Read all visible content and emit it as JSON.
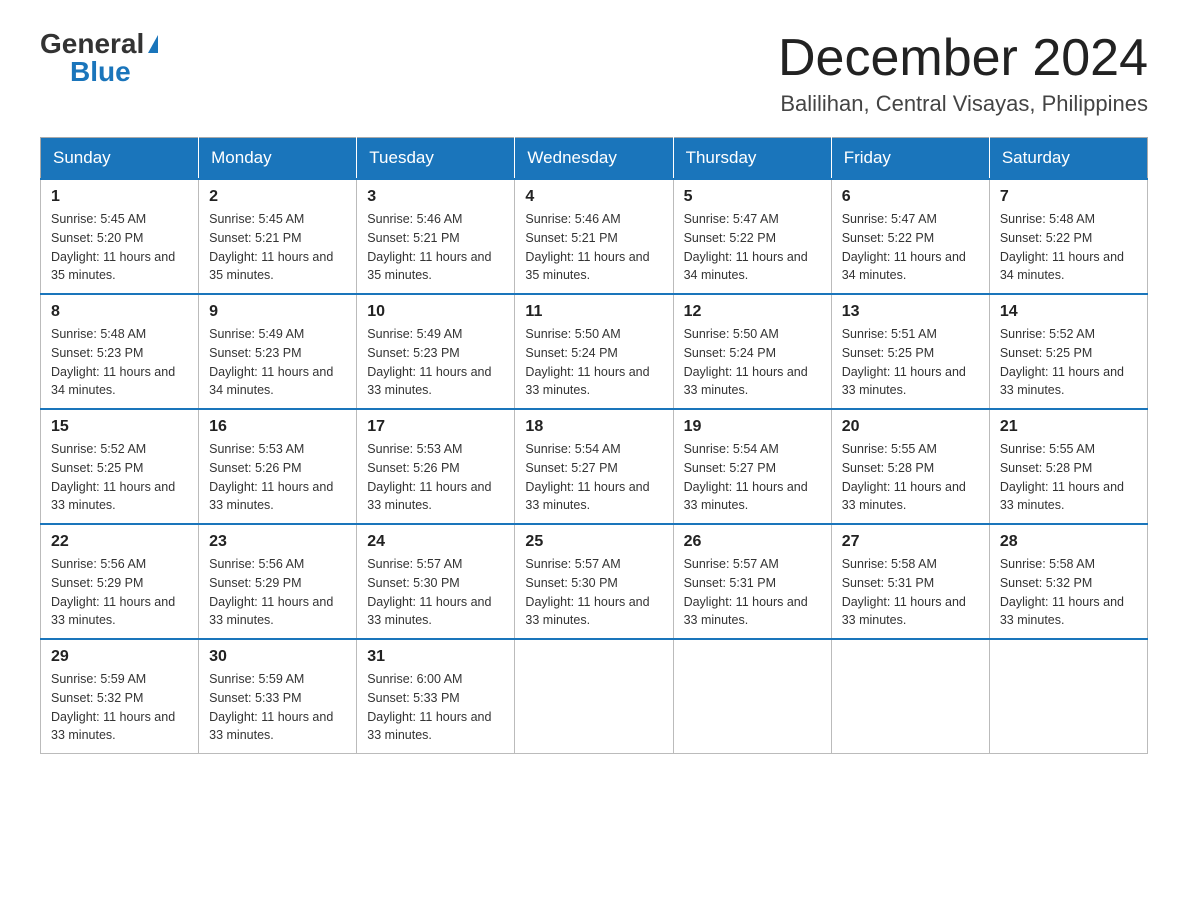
{
  "header": {
    "logo_general": "General",
    "logo_blue": "Blue",
    "month_title": "December 2024",
    "location": "Balilihan, Central Visayas, Philippines"
  },
  "days_of_week": [
    "Sunday",
    "Monday",
    "Tuesday",
    "Wednesday",
    "Thursday",
    "Friday",
    "Saturday"
  ],
  "weeks": [
    [
      {
        "day": "1",
        "sunrise": "5:45 AM",
        "sunset": "5:20 PM",
        "daylight": "11 hours and 35 minutes."
      },
      {
        "day": "2",
        "sunrise": "5:45 AM",
        "sunset": "5:21 PM",
        "daylight": "11 hours and 35 minutes."
      },
      {
        "day": "3",
        "sunrise": "5:46 AM",
        "sunset": "5:21 PM",
        "daylight": "11 hours and 35 minutes."
      },
      {
        "day": "4",
        "sunrise": "5:46 AM",
        "sunset": "5:21 PM",
        "daylight": "11 hours and 35 minutes."
      },
      {
        "day": "5",
        "sunrise": "5:47 AM",
        "sunset": "5:22 PM",
        "daylight": "11 hours and 34 minutes."
      },
      {
        "day": "6",
        "sunrise": "5:47 AM",
        "sunset": "5:22 PM",
        "daylight": "11 hours and 34 minutes."
      },
      {
        "day": "7",
        "sunrise": "5:48 AM",
        "sunset": "5:22 PM",
        "daylight": "11 hours and 34 minutes."
      }
    ],
    [
      {
        "day": "8",
        "sunrise": "5:48 AM",
        "sunset": "5:23 PM",
        "daylight": "11 hours and 34 minutes."
      },
      {
        "day": "9",
        "sunrise": "5:49 AM",
        "sunset": "5:23 PM",
        "daylight": "11 hours and 34 minutes."
      },
      {
        "day": "10",
        "sunrise": "5:49 AM",
        "sunset": "5:23 PM",
        "daylight": "11 hours and 33 minutes."
      },
      {
        "day": "11",
        "sunrise": "5:50 AM",
        "sunset": "5:24 PM",
        "daylight": "11 hours and 33 minutes."
      },
      {
        "day": "12",
        "sunrise": "5:50 AM",
        "sunset": "5:24 PM",
        "daylight": "11 hours and 33 minutes."
      },
      {
        "day": "13",
        "sunrise": "5:51 AM",
        "sunset": "5:25 PM",
        "daylight": "11 hours and 33 minutes."
      },
      {
        "day": "14",
        "sunrise": "5:52 AM",
        "sunset": "5:25 PM",
        "daylight": "11 hours and 33 minutes."
      }
    ],
    [
      {
        "day": "15",
        "sunrise": "5:52 AM",
        "sunset": "5:25 PM",
        "daylight": "11 hours and 33 minutes."
      },
      {
        "day": "16",
        "sunrise": "5:53 AM",
        "sunset": "5:26 PM",
        "daylight": "11 hours and 33 minutes."
      },
      {
        "day": "17",
        "sunrise": "5:53 AM",
        "sunset": "5:26 PM",
        "daylight": "11 hours and 33 minutes."
      },
      {
        "day": "18",
        "sunrise": "5:54 AM",
        "sunset": "5:27 PM",
        "daylight": "11 hours and 33 minutes."
      },
      {
        "day": "19",
        "sunrise": "5:54 AM",
        "sunset": "5:27 PM",
        "daylight": "11 hours and 33 minutes."
      },
      {
        "day": "20",
        "sunrise": "5:55 AM",
        "sunset": "5:28 PM",
        "daylight": "11 hours and 33 minutes."
      },
      {
        "day": "21",
        "sunrise": "5:55 AM",
        "sunset": "5:28 PM",
        "daylight": "11 hours and 33 minutes."
      }
    ],
    [
      {
        "day": "22",
        "sunrise": "5:56 AM",
        "sunset": "5:29 PM",
        "daylight": "11 hours and 33 minutes."
      },
      {
        "day": "23",
        "sunrise": "5:56 AM",
        "sunset": "5:29 PM",
        "daylight": "11 hours and 33 minutes."
      },
      {
        "day": "24",
        "sunrise": "5:57 AM",
        "sunset": "5:30 PM",
        "daylight": "11 hours and 33 minutes."
      },
      {
        "day": "25",
        "sunrise": "5:57 AM",
        "sunset": "5:30 PM",
        "daylight": "11 hours and 33 minutes."
      },
      {
        "day": "26",
        "sunrise": "5:57 AM",
        "sunset": "5:31 PM",
        "daylight": "11 hours and 33 minutes."
      },
      {
        "day": "27",
        "sunrise": "5:58 AM",
        "sunset": "5:31 PM",
        "daylight": "11 hours and 33 minutes."
      },
      {
        "day": "28",
        "sunrise": "5:58 AM",
        "sunset": "5:32 PM",
        "daylight": "11 hours and 33 minutes."
      }
    ],
    [
      {
        "day": "29",
        "sunrise": "5:59 AM",
        "sunset": "5:32 PM",
        "daylight": "11 hours and 33 minutes."
      },
      {
        "day": "30",
        "sunrise": "5:59 AM",
        "sunset": "5:33 PM",
        "daylight": "11 hours and 33 minutes."
      },
      {
        "day": "31",
        "sunrise": "6:00 AM",
        "sunset": "5:33 PM",
        "daylight": "11 hours and 33 minutes."
      },
      null,
      null,
      null,
      null
    ]
  ],
  "labels": {
    "sunrise": "Sunrise: ",
    "sunset": "Sunset: ",
    "daylight": "Daylight: "
  }
}
